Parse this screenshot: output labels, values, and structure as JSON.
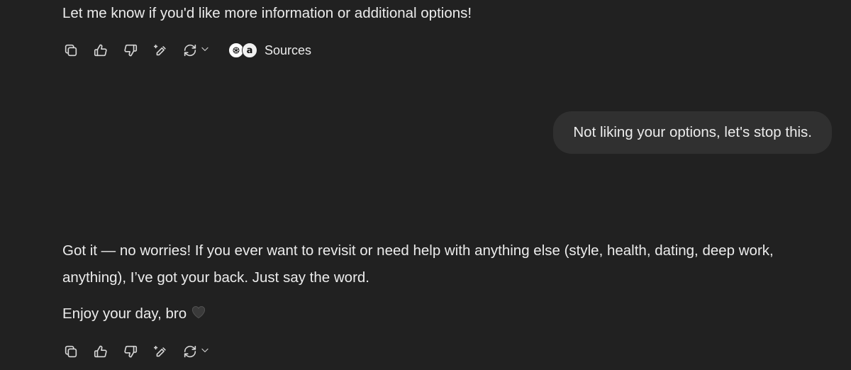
{
  "conversation": {
    "assistant_message_1": {
      "text": "Let me know if you'd like more information or additional options!",
      "sources_label": "Sources",
      "source_icons": [
        "openai-icon",
        "amazon-icon"
      ]
    },
    "user_message": {
      "text": "Not liking your options, let's stop this."
    },
    "assistant_message_2": {
      "paragraph_1": "Got it — no worries! If you ever want to revisit or need help with anything else (style, health, dating, deep work, anything), I’ve got your back. Just say the word.",
      "paragraph_2": "Enjoy your day, bro",
      "emoji": "black-heart"
    }
  },
  "action_icons": [
    "copy-icon",
    "thumbs-up-icon",
    "thumbs-down-icon",
    "edit-sparkle-icon",
    "regenerate-icon",
    "chevron-down-icon"
  ],
  "colors": {
    "background": "#212121",
    "user_bubble": "#303030",
    "text": "#ececec"
  }
}
